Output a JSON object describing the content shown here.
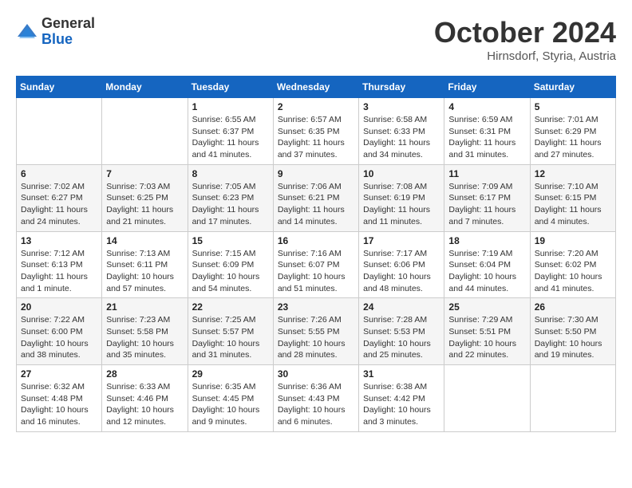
{
  "header": {
    "logo_line1": "General",
    "logo_line2": "Blue",
    "month": "October 2024",
    "location": "Hirnsdorf, Styria, Austria"
  },
  "weekdays": [
    "Sunday",
    "Monday",
    "Tuesday",
    "Wednesday",
    "Thursday",
    "Friday",
    "Saturday"
  ],
  "weeks": [
    [
      {
        "day": "",
        "info": ""
      },
      {
        "day": "",
        "info": ""
      },
      {
        "day": "1",
        "info": "Sunrise: 6:55 AM\nSunset: 6:37 PM\nDaylight: 11 hours and 41 minutes."
      },
      {
        "day": "2",
        "info": "Sunrise: 6:57 AM\nSunset: 6:35 PM\nDaylight: 11 hours and 37 minutes."
      },
      {
        "day": "3",
        "info": "Sunrise: 6:58 AM\nSunset: 6:33 PM\nDaylight: 11 hours and 34 minutes."
      },
      {
        "day": "4",
        "info": "Sunrise: 6:59 AM\nSunset: 6:31 PM\nDaylight: 11 hours and 31 minutes."
      },
      {
        "day": "5",
        "info": "Sunrise: 7:01 AM\nSunset: 6:29 PM\nDaylight: 11 hours and 27 minutes."
      }
    ],
    [
      {
        "day": "6",
        "info": "Sunrise: 7:02 AM\nSunset: 6:27 PM\nDaylight: 11 hours and 24 minutes."
      },
      {
        "day": "7",
        "info": "Sunrise: 7:03 AM\nSunset: 6:25 PM\nDaylight: 11 hours and 21 minutes."
      },
      {
        "day": "8",
        "info": "Sunrise: 7:05 AM\nSunset: 6:23 PM\nDaylight: 11 hours and 17 minutes."
      },
      {
        "day": "9",
        "info": "Sunrise: 7:06 AM\nSunset: 6:21 PM\nDaylight: 11 hours and 14 minutes."
      },
      {
        "day": "10",
        "info": "Sunrise: 7:08 AM\nSunset: 6:19 PM\nDaylight: 11 hours and 11 minutes."
      },
      {
        "day": "11",
        "info": "Sunrise: 7:09 AM\nSunset: 6:17 PM\nDaylight: 11 hours and 7 minutes."
      },
      {
        "day": "12",
        "info": "Sunrise: 7:10 AM\nSunset: 6:15 PM\nDaylight: 11 hours and 4 minutes."
      }
    ],
    [
      {
        "day": "13",
        "info": "Sunrise: 7:12 AM\nSunset: 6:13 PM\nDaylight: 11 hours and 1 minute."
      },
      {
        "day": "14",
        "info": "Sunrise: 7:13 AM\nSunset: 6:11 PM\nDaylight: 10 hours and 57 minutes."
      },
      {
        "day": "15",
        "info": "Sunrise: 7:15 AM\nSunset: 6:09 PM\nDaylight: 10 hours and 54 minutes."
      },
      {
        "day": "16",
        "info": "Sunrise: 7:16 AM\nSunset: 6:07 PM\nDaylight: 10 hours and 51 minutes."
      },
      {
        "day": "17",
        "info": "Sunrise: 7:17 AM\nSunset: 6:06 PM\nDaylight: 10 hours and 48 minutes."
      },
      {
        "day": "18",
        "info": "Sunrise: 7:19 AM\nSunset: 6:04 PM\nDaylight: 10 hours and 44 minutes."
      },
      {
        "day": "19",
        "info": "Sunrise: 7:20 AM\nSunset: 6:02 PM\nDaylight: 10 hours and 41 minutes."
      }
    ],
    [
      {
        "day": "20",
        "info": "Sunrise: 7:22 AM\nSunset: 6:00 PM\nDaylight: 10 hours and 38 minutes."
      },
      {
        "day": "21",
        "info": "Sunrise: 7:23 AM\nSunset: 5:58 PM\nDaylight: 10 hours and 35 minutes."
      },
      {
        "day": "22",
        "info": "Sunrise: 7:25 AM\nSunset: 5:57 PM\nDaylight: 10 hours and 31 minutes."
      },
      {
        "day": "23",
        "info": "Sunrise: 7:26 AM\nSunset: 5:55 PM\nDaylight: 10 hours and 28 minutes."
      },
      {
        "day": "24",
        "info": "Sunrise: 7:28 AM\nSunset: 5:53 PM\nDaylight: 10 hours and 25 minutes."
      },
      {
        "day": "25",
        "info": "Sunrise: 7:29 AM\nSunset: 5:51 PM\nDaylight: 10 hours and 22 minutes."
      },
      {
        "day": "26",
        "info": "Sunrise: 7:30 AM\nSunset: 5:50 PM\nDaylight: 10 hours and 19 minutes."
      }
    ],
    [
      {
        "day": "27",
        "info": "Sunrise: 6:32 AM\nSunset: 4:48 PM\nDaylight: 10 hours and 16 minutes."
      },
      {
        "day": "28",
        "info": "Sunrise: 6:33 AM\nSunset: 4:46 PM\nDaylight: 10 hours and 12 minutes."
      },
      {
        "day": "29",
        "info": "Sunrise: 6:35 AM\nSunset: 4:45 PM\nDaylight: 10 hours and 9 minutes."
      },
      {
        "day": "30",
        "info": "Sunrise: 6:36 AM\nSunset: 4:43 PM\nDaylight: 10 hours and 6 minutes."
      },
      {
        "day": "31",
        "info": "Sunrise: 6:38 AM\nSunset: 4:42 PM\nDaylight: 10 hours and 3 minutes."
      },
      {
        "day": "",
        "info": ""
      },
      {
        "day": "",
        "info": ""
      }
    ]
  ]
}
